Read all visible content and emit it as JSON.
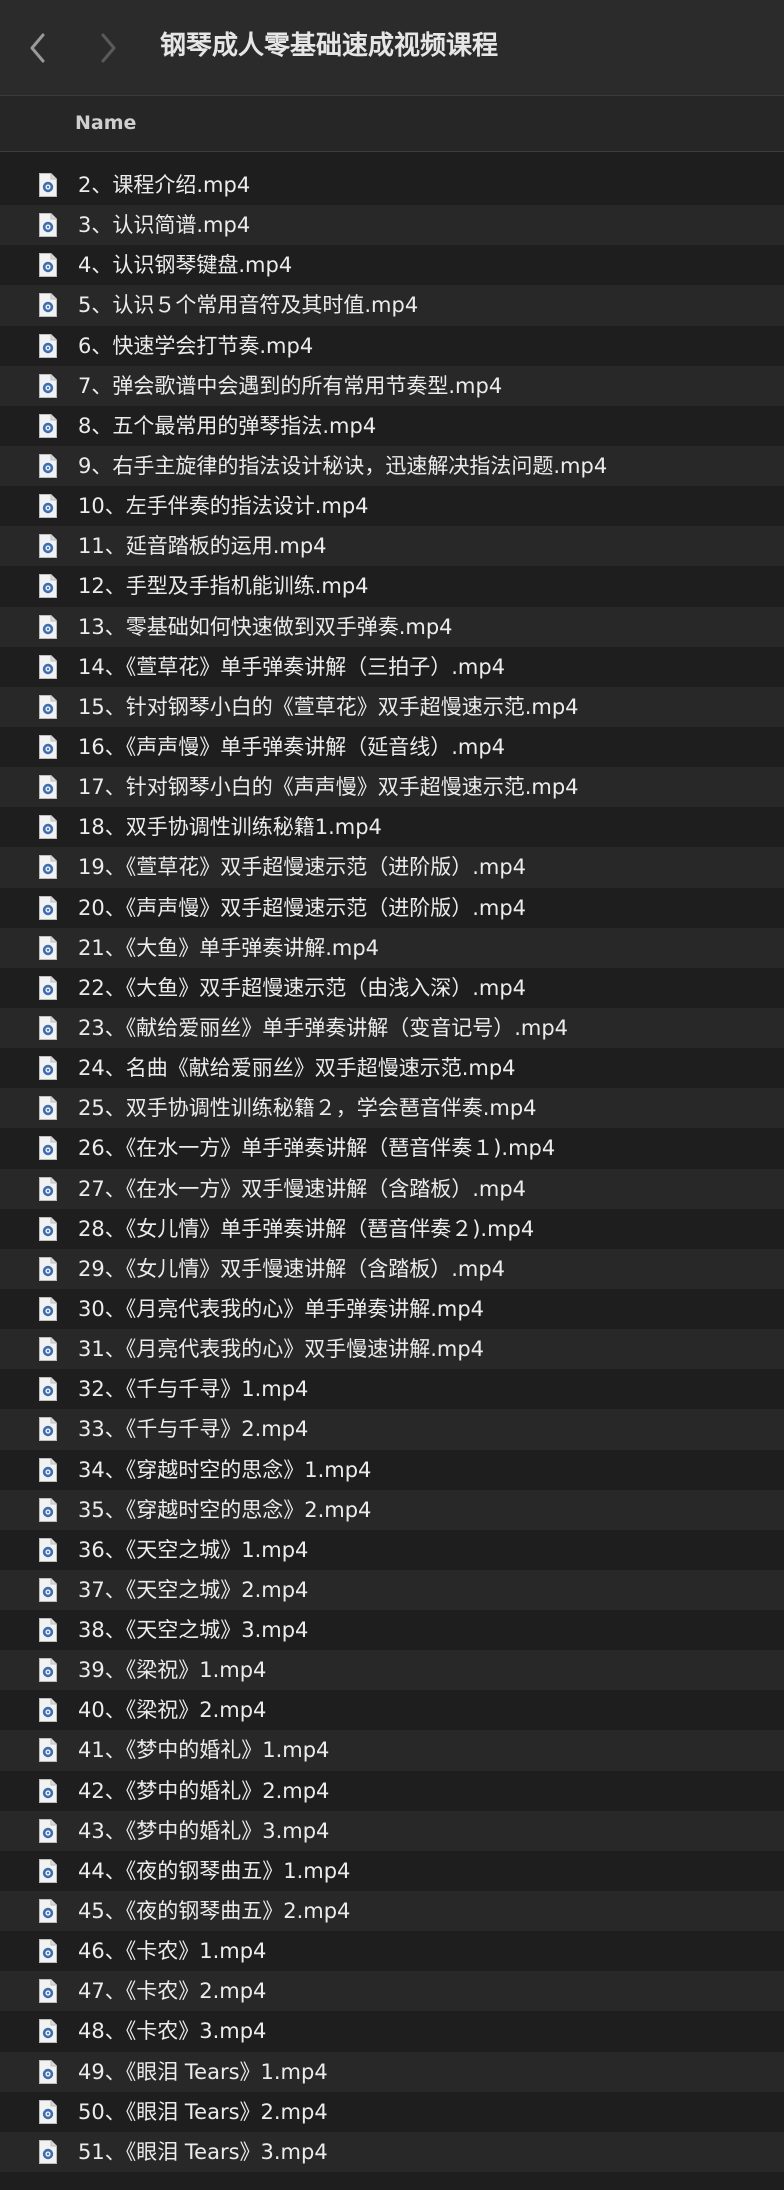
{
  "toolbar": {
    "title": "钢琴成人零基础速成视频课程",
    "back_icon": "chevron-left-icon",
    "forward_icon": "chevron-right-icon"
  },
  "header": {
    "name_column": "Name"
  },
  "file_icon": "video-file-icon",
  "colors": {
    "background": "#1e1e1e",
    "row_alt": "#282828",
    "toolbar": "#2b2b2b",
    "icon_accent": "#3d6fae"
  },
  "files": [
    "2、课程介绍.mp4",
    "3、认识简谱.mp4",
    "4、认识钢琴键盘.mp4",
    "5、认识５个常用音符及其时值.mp4",
    "6、快速学会打节奏.mp4",
    "7、弹会歌谱中会遇到的所有常用节奏型.mp4",
    "8、五个最常用的弹琴指法.mp4",
    "9、右手主旋律的指法设计秘诀，迅速解决指法问题.mp4",
    "10、左手伴奏的指法设计.mp4",
    "11、延音踏板的运用.mp4",
    "12、手型及手指机能训练.mp4",
    "13、零基础如何快速做到双手弹奏.mp4",
    "14、《萱草花》单手弹奏讲解（三拍子）.mp4",
    "15、针对钢琴小白的《萱草花》双手超慢速示范.mp4",
    "16、《声声慢》单手弹奏讲解（延音线）.mp4",
    "17、针对钢琴小白的《声声慢》双手超慢速示范.mp4",
    "18、双手协调性训练秘籍1.mp4",
    "19、《萱草花》双手超慢速示范（进阶版）.mp4",
    "20、《声声慢》双手超慢速示范（进阶版）.mp4",
    "21、《大鱼》单手弹奏讲解.mp4",
    "22、《大鱼》双手超慢速示范（由浅入深）.mp4",
    "23、《献给爱丽丝》单手弹奏讲解（变音记号）.mp4",
    "24、名曲《献给爱丽丝》双手超慢速示范.mp4",
    "25、双手协调性训练秘籍２，学会琶音伴奏.mp4",
    "26、《在水一方》单手弹奏讲解（琶音伴奏１).mp4",
    "27、《在水一方》双手慢速讲解（含踏板）.mp4",
    "28、《女儿情》单手弹奏讲解（琶音伴奏２).mp4",
    "29、《女儿情》双手慢速讲解（含踏板）.mp4",
    "30、《月亮代表我的心》单手弹奏讲解.mp4",
    "31、《月亮代表我的心》双手慢速讲解.mp4",
    "32、《千与千寻》1.mp4",
    "33、《千与千寻》2.mp4",
    "34、《穿越时空的思念》1.mp4",
    "35、《穿越时空的思念》2.mp4",
    "36、《天空之城》1.mp4",
    "37、《天空之城》2.mp4",
    "38、《天空之城》3.mp4",
    "39、《梁祝》1.mp4",
    "40、《梁祝》2.mp4",
    "41、《梦中的婚礼》1.mp4",
    "42、《梦中的婚礼》2.mp4",
    "43、《梦中的婚礼》3.mp4",
    "44、《夜的钢琴曲五》1.mp4",
    "45、《夜的钢琴曲五》2.mp4",
    "46、《卡农》1.mp4",
    "47、《卡农》2.mp4",
    "48、《卡农》3.mp4",
    "49、《眼泪 Tears》1.mp4",
    "50、《眼泪 Tears》2.mp4",
    "51、《眼泪 Tears》3.mp4"
  ]
}
